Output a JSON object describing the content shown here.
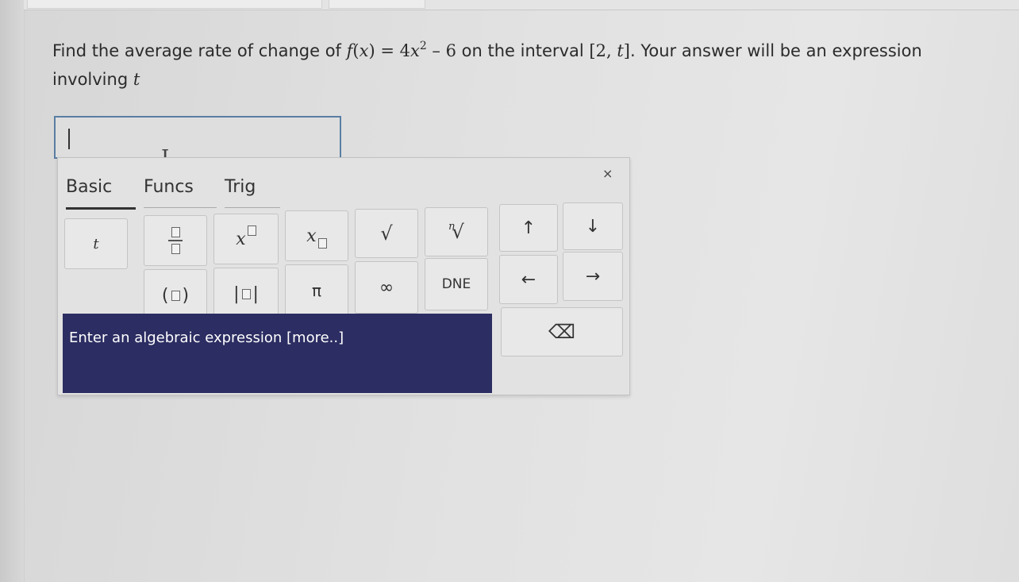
{
  "question": {
    "prefix": "Find the average rate of change of ",
    "func_name": "f",
    "func_var": "x",
    "coef": "4",
    "var": "x",
    "exp": "2",
    "minus": "–",
    "const": "6",
    "mid": " on the interval ",
    "interval_start": "2",
    "interval_end": "t",
    "suffix": ". Your answer will be an expression",
    "line2_prefix": "involving ",
    "line2_var": "t"
  },
  "answer": {
    "value": ""
  },
  "palette": {
    "close_glyph": "×",
    "tabs": [
      {
        "label": "Basic",
        "active": true
      },
      {
        "label": "Funcs",
        "active": false
      },
      {
        "label": "Trig",
        "active": false
      }
    ],
    "keys": {
      "t": "t",
      "x": "x",
      "pi": "π",
      "infinity": "∞",
      "dne": "DNE",
      "sqrt": "√",
      "nroot_index": "n",
      "nroot_radical": "√",
      "up": "↑",
      "down": "↓",
      "left": "←",
      "right": "→",
      "paren_open": "(",
      "paren_close": ")",
      "abs_bar": "|",
      "backspace": "⌫"
    },
    "help_text": "Enter an algebraic expression",
    "help_more": "[more..]"
  },
  "icons": [
    "close-icon",
    "sqrt-icon",
    "nth-root-icon",
    "arrow-up-icon",
    "arrow-down-icon",
    "arrow-left-icon",
    "arrow-right-icon",
    "backspace-icon",
    "text-cursor-icon"
  ]
}
